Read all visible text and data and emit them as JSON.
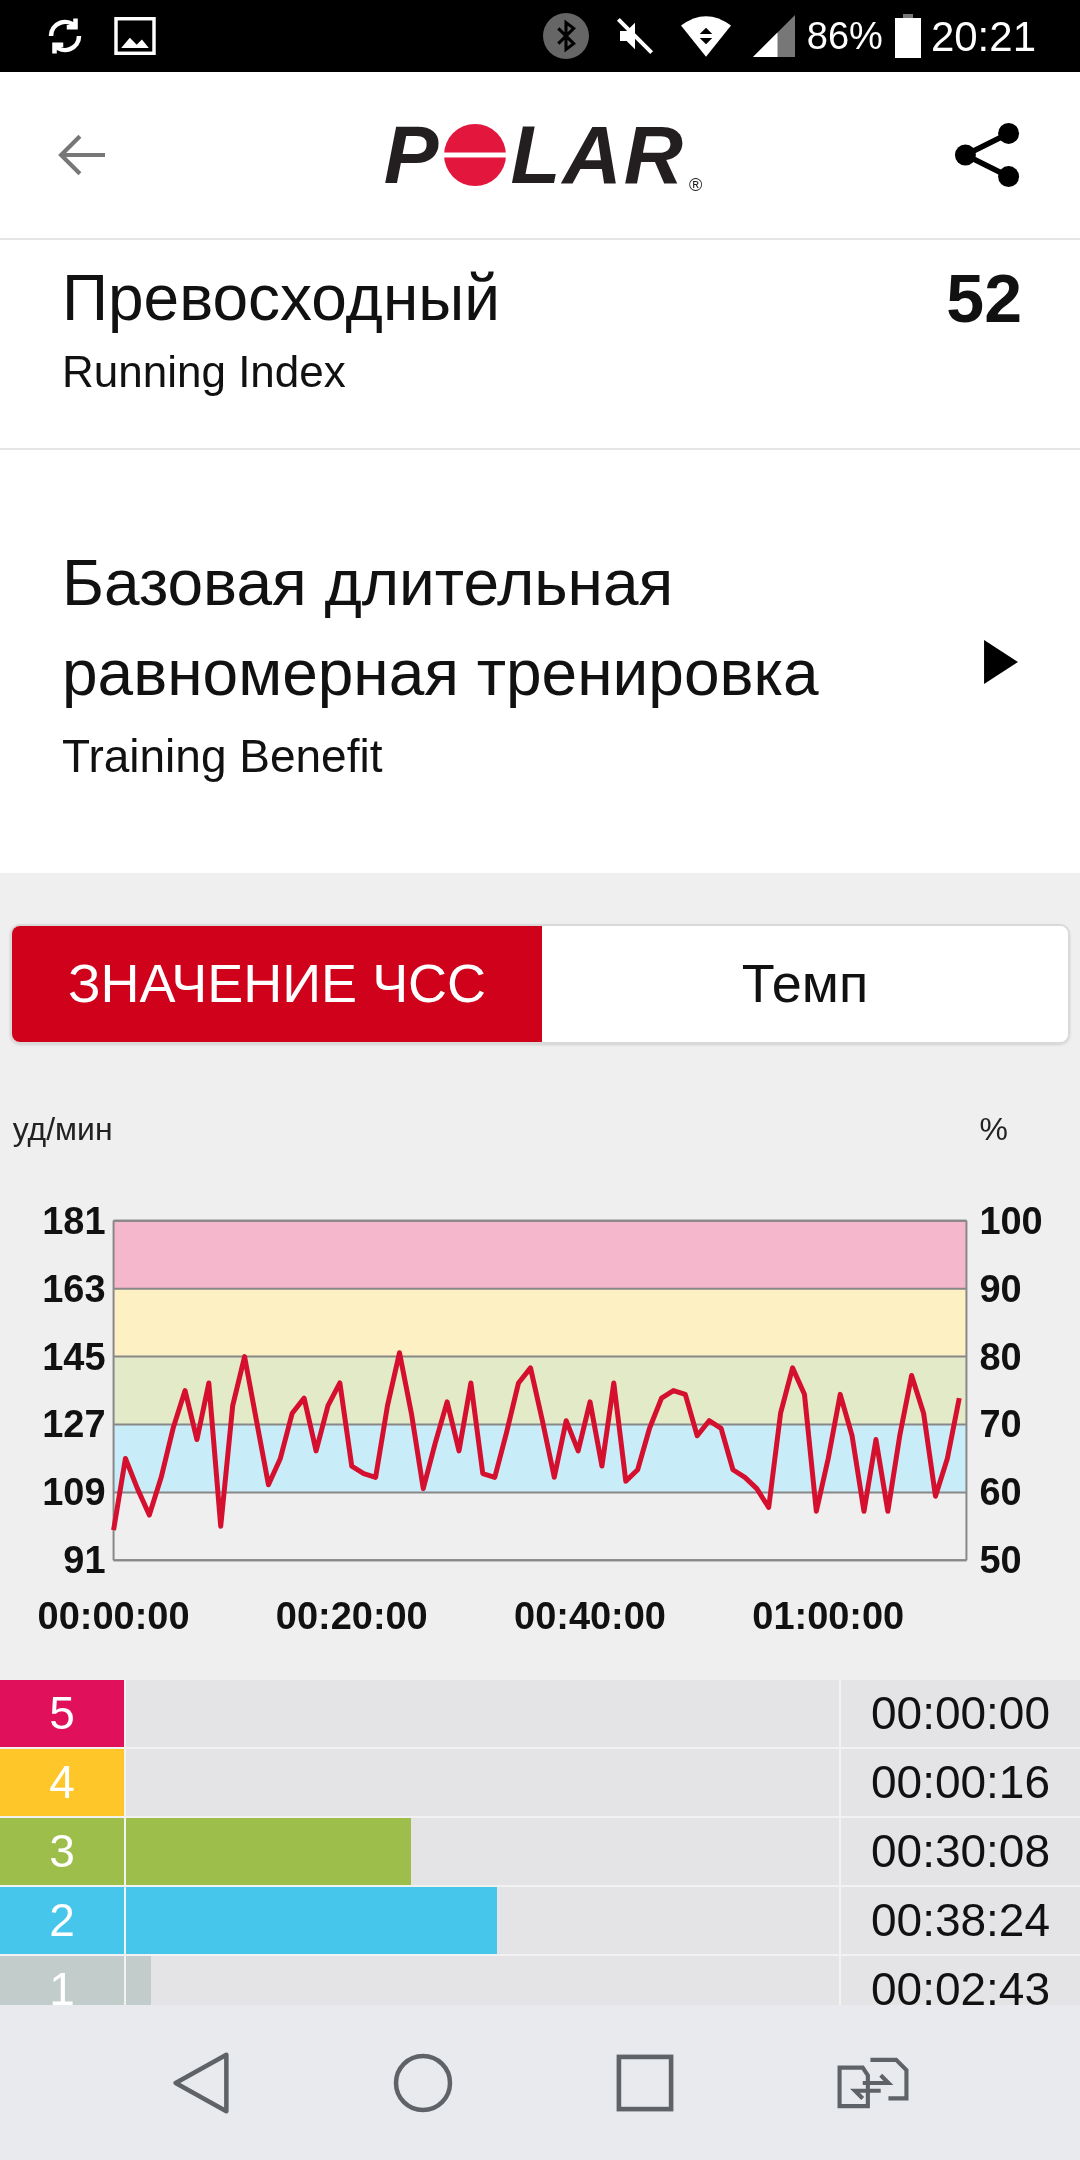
{
  "status_bar": {
    "battery": "86%",
    "time": "20:21"
  },
  "header": {
    "logo": [
      "P",
      "LAR"
    ],
    "registered": "®"
  },
  "running_index": {
    "rating": "Превосходный",
    "label": "Running Index",
    "value": "52"
  },
  "training_benefit": {
    "title": "Базовая длительная равномерная тренировка",
    "label": "Training Benefit"
  },
  "tabs": [
    {
      "label": "ЗНАЧЕНИЕ ЧСС",
      "selected": true
    },
    {
      "label": "Темп",
      "selected": false
    }
  ],
  "chart": {
    "unit_left": "уд/мин",
    "unit_right": "%",
    "right_ticks": [
      "100",
      "90",
      "80",
      "70",
      "60",
      "50"
    ],
    "chart_data": {
      "type": "line",
      "grid": true,
      "bands": [
        {
          "axis": "y",
          "from": 163,
          "to": 181,
          "color": "#f4b7cb"
        },
        {
          "axis": "y",
          "from": 145,
          "to": 163,
          "color": "#fdf0c3"
        },
        {
          "axis": "y",
          "from": 127,
          "to": 145,
          "color": "#e2eac8"
        },
        {
          "axis": "y",
          "from": 109,
          "to": 127,
          "color": "#c8ecf8"
        }
      ],
      "x": [
        0,
        1,
        2,
        3,
        4,
        5,
        6,
        7,
        8,
        9,
        10,
        11,
        12,
        13,
        14,
        15,
        16,
        17,
        18,
        19,
        20,
        21,
        22,
        23,
        24,
        25,
        26,
        27,
        28,
        29,
        30,
        31,
        32,
        33,
        34,
        35,
        36,
        37,
        38,
        39,
        40,
        41,
        42,
        43,
        44,
        45,
        46,
        47,
        48,
        49,
        50,
        51,
        52,
        53,
        54,
        55,
        56,
        57,
        58,
        59,
        60,
        61,
        62,
        63,
        64,
        65,
        66,
        67,
        68,
        69,
        70,
        71
      ],
      "series": [
        {
          "color": "#d5102f",
          "values": [
            99,
            118,
            110,
            103,
            113,
            126,
            136,
            123,
            138,
            100,
            132,
            145,
            128,
            111,
            118,
            130,
            134,
            120,
            132,
            138,
            116,
            114,
            113,
            132,
            146,
            130,
            110,
            122,
            133,
            120,
            138,
            114,
            113,
            125,
            138,
            142,
            128,
            113,
            128,
            120,
            133,
            116,
            138,
            112,
            115,
            126,
            134,
            136,
            135,
            124,
            128,
            126,
            115,
            113,
            110,
            105,
            130,
            142,
            135,
            104,
            118,
            135,
            124,
            104,
            123,
            104,
            124,
            140,
            130,
            108,
            118,
            134
          ]
        }
      ],
      "xlim": [
        0,
        71.6
      ],
      "ylim": [
        91,
        181
      ],
      "xticks": [
        {
          "value": 0,
          "label": "00:00:00"
        },
        {
          "value": 20,
          "label": "00:20:00"
        },
        {
          "value": 40,
          "label": "00:40:00"
        },
        {
          "value": 60,
          "label": "01:00:00"
        }
      ],
      "yticks": [
        91,
        109,
        127,
        145,
        163,
        181
      ]
    }
  },
  "zones": [
    {
      "number": "5",
      "color": "#e0105a",
      "time": "00:00:00"
    },
    {
      "number": "4",
      "color": "#ffc62a",
      "time": "00:00:16"
    },
    {
      "number": "3",
      "color": "#9dbe4a",
      "level": 0.4,
      "time": "00:30:08"
    },
    {
      "number": "2",
      "color": "#47c6ec",
      "level": 0.52,
      "time": "00:38:24"
    },
    {
      "number": "1",
      "color": "#c2cccb",
      "level": 0.035,
      "time": "00:02:43"
    }
  ]
}
